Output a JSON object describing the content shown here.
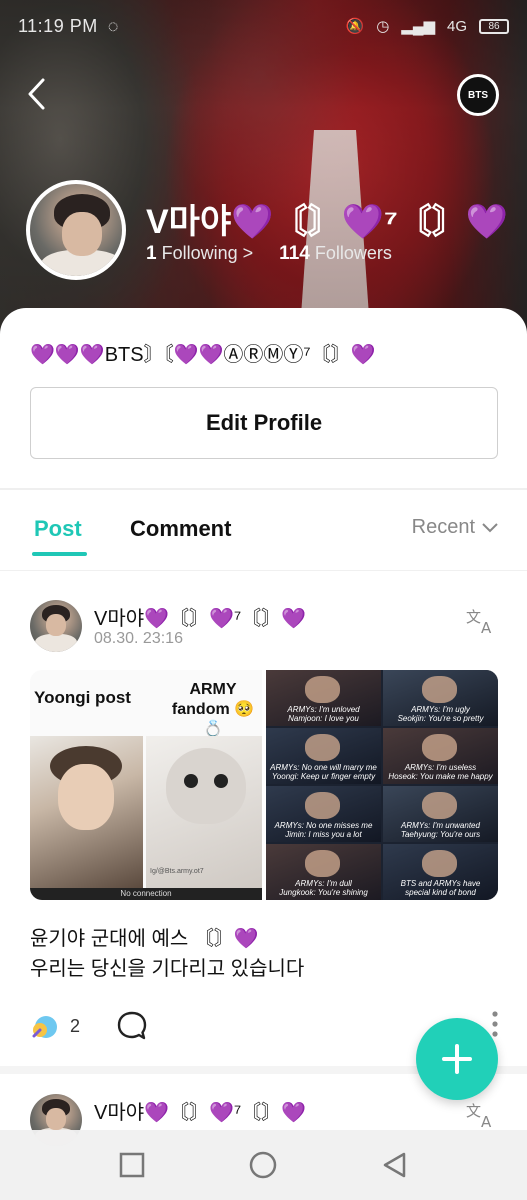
{
  "status_bar": {
    "time": "11:19 PM",
    "network": "4G",
    "battery": "86"
  },
  "header": {
    "back_icon": "chevron-left-icon",
    "badge_text": "BTS",
    "profile_name": "V마야💜〘〙💜⁷〘〙💜",
    "following_count": "1",
    "following_label": "Following",
    "following_chevron": ">",
    "followers_count": "114",
    "followers_label": "Followers"
  },
  "profile": {
    "bio": "💜💜💜BTS〙〘💜💜ⒶⓇⓂⓎ⁷〘〙💜",
    "edit_button": "Edit Profile"
  },
  "tabs": [
    {
      "label": "Post",
      "active": true
    },
    {
      "label": "Comment",
      "active": false
    }
  ],
  "sort": {
    "label": "Recent"
  },
  "posts": [
    {
      "author": "V마야💜〘〙💜⁷〘〙💜",
      "timestamp": "08.30. 23:16",
      "media_left": {
        "title1": "Yoongi post",
        "title2_line1": "ARMY",
        "title2_line2": "fandom 🥺💍",
        "credit": "Ig/@Bts.army.ot7",
        "caption": "No connection"
      },
      "media_right": [
        "ARMYs: I'm unloved\nNamjoon: I love you",
        "ARMYs: I'm ugly\nSeokjin: You're so pretty",
        "ARMYs: No one will marry me\nYoongi: Keep ur finger empty",
        "ARMYs: I'm useless\nHoseok: You make me happy",
        "ARMYs: No one misses me\nJimin: I miss you a lot",
        "ARMYs: I'm unwanted\nTaehyung: You're ours",
        "ARMYs: I'm dull\nJungkook: You're shining",
        "BTS and ARMYs have\nspecial kind of bond"
      ],
      "text_line1": "윤기야 군대에 예스 〘〙💜",
      "text_line2": "우리는 당신을 기다리고 있습니다",
      "like_count": "2"
    },
    {
      "author": "V마야💜〘〙💜⁷〘〙💜"
    }
  ],
  "colors": {
    "accent": "#1fc7b6",
    "fab": "#21d0b8"
  }
}
